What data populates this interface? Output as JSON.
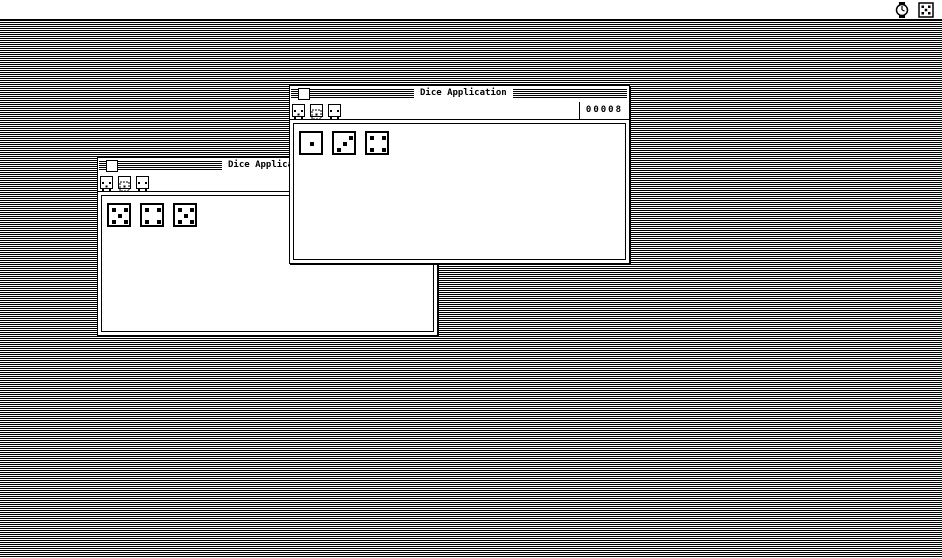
{
  "menubar": {
    "icons": [
      "watch-icon",
      "dice-icon"
    ]
  },
  "windows": [
    {
      "id": "back",
      "title": "Dice Applicat",
      "toolbar_icons": [
        "roll-icon",
        "hold-icon",
        "reset-icon"
      ],
      "dice": [
        5,
        4,
        5
      ]
    },
    {
      "id": "front",
      "title": "Dice Application",
      "counter": "00008",
      "toolbar_icons": [
        "roll-icon",
        "hold-icon",
        "reset-icon"
      ],
      "dice": [
        1,
        3,
        4
      ]
    }
  ]
}
